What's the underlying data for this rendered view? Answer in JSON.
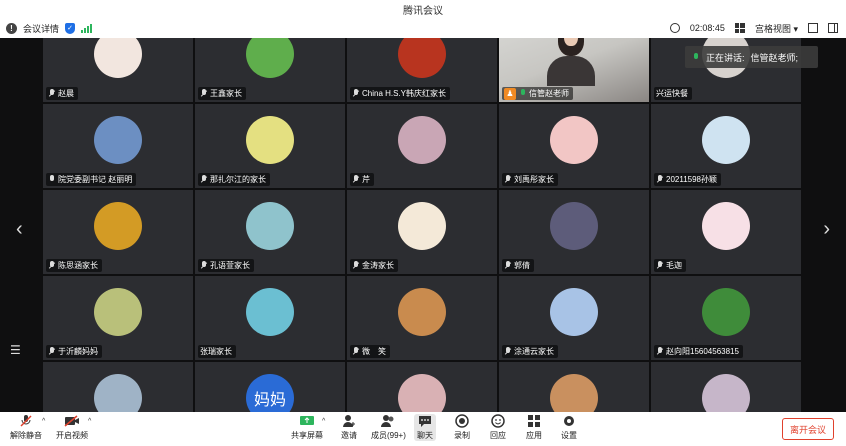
{
  "window": {
    "title": "腾讯会议"
  },
  "topbar": {
    "meeting_details": "会议详情",
    "timer": "02:08:45",
    "view_mode": "宫格视图"
  },
  "speaking": {
    "label": "正在讲话:",
    "name": "信管赵老师;"
  },
  "tiles": [
    {
      "name": "赵晨",
      "mic": "muted",
      "avatar_color": "#f2e6df"
    },
    {
      "name": "王鑫家长",
      "mic": "muted",
      "avatar_color": "#5fae4c"
    },
    {
      "name": "China H.S.Y韩庆红家长",
      "mic": "muted",
      "avatar_color": "#b8341f"
    },
    {
      "name": "信管赵老师",
      "mic": "active",
      "host": true,
      "video": true
    },
    {
      "name": "兴运快餐",
      "mic": "none",
      "avatar_color": "#d7d2ce"
    },
    {
      "name": "院党委副书记 赵丽明",
      "mic": "unmuted",
      "avatar_color": "#6c8fc2"
    },
    {
      "name": "那扎尔江的家长",
      "mic": "muted",
      "avatar_color": "#e4e081"
    },
    {
      "name": "芹",
      "mic": "muted",
      "avatar_color": "#c9a6b5"
    },
    {
      "name": "刘禹彤家长",
      "mic": "muted",
      "avatar_color": "#f2c6c5"
    },
    {
      "name": "20211598孙颖",
      "mic": "muted",
      "avatar_color": "#cfe3f1"
    },
    {
      "name": "陈思涵家长",
      "mic": "muted",
      "avatar_color": "#d39b25"
    },
    {
      "name": "孔语萱家长",
      "mic": "muted",
      "avatar_color": "#8fc3cc"
    },
    {
      "name": "金涛家长",
      "mic": "muted",
      "avatar_color": "#f4e9d8"
    },
    {
      "name": "郭倩",
      "mic": "muted",
      "avatar_color": "#5d5c7a"
    },
    {
      "name": "毛迦",
      "mic": "muted",
      "avatar_color": "#f7e0e6"
    },
    {
      "name": "于沂麟妈妈",
      "mic": "muted",
      "avatar_color": "#b9c07a"
    },
    {
      "name": "张瑞家长",
      "mic": "none",
      "avatar_color": "#6bbfd2"
    },
    {
      "name": "微　笑",
      "mic": "muted",
      "avatar_color": "#c98b4e"
    },
    {
      "name": "涂通云家长",
      "mic": "muted",
      "avatar_color": "#a8c3e6"
    },
    {
      "name": "赵向阳15604563815",
      "mic": "muted",
      "avatar_color": "#3f8c3a"
    },
    {
      "name": "",
      "mic": "none",
      "avatar_color": "#9fb3c6"
    },
    {
      "name": "",
      "mic": "none",
      "avatar_color": "#2a6bd6",
      "avatar_text": "妈妈"
    },
    {
      "name": "",
      "mic": "none",
      "avatar_color": "#d9b1b4"
    },
    {
      "name": "",
      "mic": "none",
      "avatar_color": "#c9905f"
    },
    {
      "name": "",
      "mic": "none",
      "avatar_color": "#c6b6c9"
    }
  ],
  "toolbar": {
    "unmute": "解除静音",
    "start_video": "开启视频",
    "share_screen": "共享屏幕",
    "invite": "邀请",
    "members": "成员(99+)",
    "chat": "聊天",
    "record": "录制",
    "react": "回应",
    "apps": "应用",
    "settings": "设置",
    "leave": "离开会议"
  },
  "colors": {
    "accent": "#1f6fe5",
    "leave": "#e0412d",
    "host": "#f08a24",
    "active_mic": "#2db55d"
  }
}
